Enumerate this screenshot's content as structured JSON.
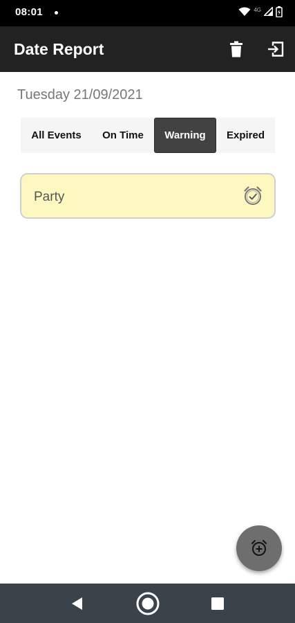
{
  "status_bar": {
    "time": "08:01",
    "network_label": "4G"
  },
  "app_bar": {
    "title": "Date Report",
    "actions": [
      "trash-icon",
      "exit-icon"
    ]
  },
  "date_heading": "Tuesday 21/09/2021",
  "tabs": [
    {
      "label": "All Events",
      "selected": false
    },
    {
      "label": "On Time",
      "selected": false
    },
    {
      "label": "Warning",
      "selected": true
    },
    {
      "label": "Expired",
      "selected": false
    }
  ],
  "events": [
    {
      "name": "Party",
      "status_icon": "alarm-check-icon",
      "background_color": "#fdf7c0"
    }
  ],
  "fab": {
    "icon": "alarm-add-icon"
  },
  "nav_bar": {
    "buttons": [
      "back-icon",
      "home-icon",
      "recents-icon"
    ]
  },
  "colors": {
    "app_bar": "#222222",
    "selected_tab": "#424242",
    "warning_card": "#fdf7c0",
    "fab": "#6e6e6e",
    "nav_bar": "#3a4349"
  }
}
